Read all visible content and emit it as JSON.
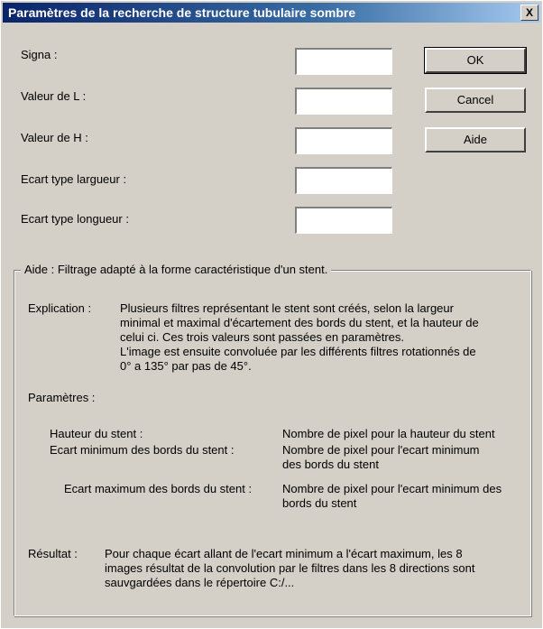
{
  "window": {
    "title": "Paramètres de la recherche de structure tubulaire sombre",
    "close": "X"
  },
  "fields": [
    {
      "label": "Signa :",
      "value": ""
    },
    {
      "label": "Valeur de L :",
      "value": ""
    },
    {
      "label": "Valeur de H :",
      "value": ""
    },
    {
      "label": "Ecart type largueur :",
      "value": ""
    },
    {
      "label": "Ecart type longueur :",
      "value": ""
    }
  ],
  "buttons": {
    "ok": "OK",
    "cancel": "Cancel",
    "help": "Aide"
  },
  "help": {
    "title": "Aide : Filtrage adapté à la forme caractéristique d'un stent.",
    "explication_label": "Explication :",
    "explication_lines": [
      "Plusieurs filtres représentant le stent sont créés, selon la largeur",
      "minimal et maximal d'écartement des bords du stent, et la hauteur de",
      "celui ci. Ces trois valeurs sont passées en paramètres.",
      "L'image est ensuite convoluée par les différents filtres rotationnés de",
      "0° a 135° par pas de 45°."
    ],
    "parametres_label": "Paramètres :",
    "params": [
      {
        "name": "Hauteur du stent :",
        "desc_lines": [
          "Nombre de pixel pour la hauteur du stent"
        ]
      },
      {
        "name": "Ecart minimum des bords du stent :",
        "desc_lines": [
          "Nombre de pixel pour l'ecart minimum",
          "des bords du stent"
        ]
      },
      {
        "name": "Ecart maximum des bords du stent :",
        "desc_lines": [
          "Nombre de pixel pour l'ecart minimum des",
          "bords du stent"
        ]
      }
    ],
    "resultat_label": "Résultat :",
    "resultat_lines": [
      "Pour chaque écart allant de l'ecart minimum a l'écart maximum, les 8",
      "images résultat de la convolution par le filtres dans les 8 directions sont",
      "sauvgardées dans le répertoire C:/..."
    ]
  }
}
